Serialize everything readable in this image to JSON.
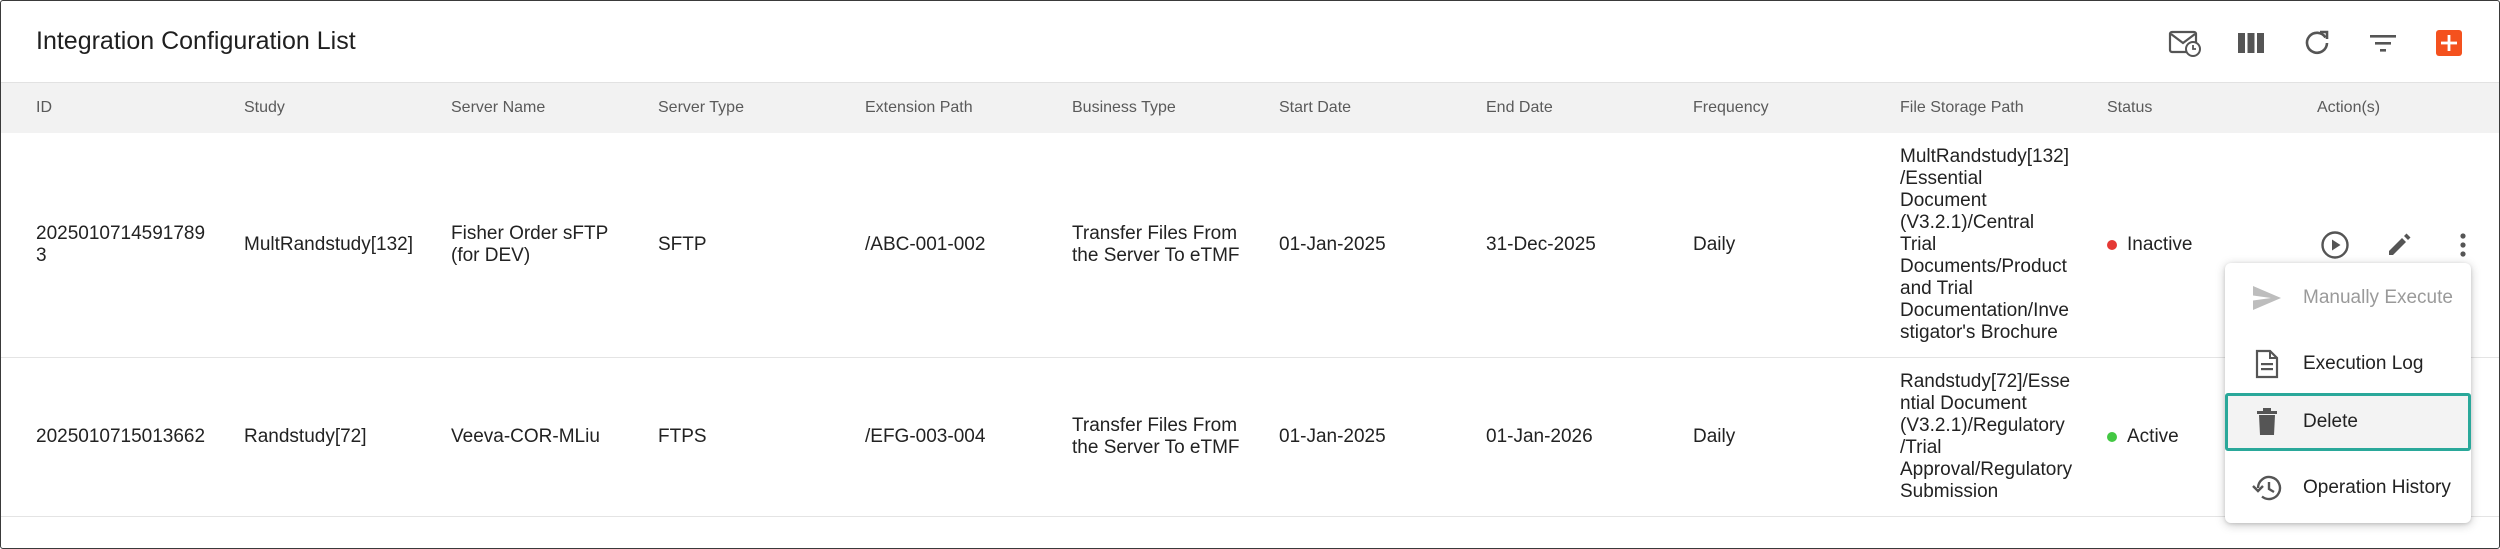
{
  "page": {
    "title": "Integration Configuration List"
  },
  "toolbar": {
    "icons": [
      "mail-schedule-icon",
      "columns-icon",
      "refresh-icon",
      "filter-icon",
      "add-icon"
    ],
    "accent": "#f4511e"
  },
  "table": {
    "columns": [
      "ID",
      "Study",
      "Server Name",
      "Server Type",
      "Extension Path",
      "Business Type",
      "Start Date",
      "End Date",
      "Frequency",
      "File Storage Path",
      "Status",
      "Action(s)"
    ],
    "rows": [
      {
        "id": "2025010714591789\n3",
        "study": "MultRandstudy[132]",
        "server_name": "Fisher Order sFTP\n(for DEV)",
        "server_type": "SFTP",
        "extension_path": "/ABC-001-002",
        "business_type": "Transfer Files From\nthe Server To eTMF",
        "start_date": "01-Jan-2025",
        "end_date": "31-Dec-2025",
        "frequency": "Daily",
        "file_storage_path": "MultRandstudy[132]\n/Essential\nDocument\n(V3.2.1)/Central\nTrial\nDocuments/Product\nand Trial\nDocumentation/Inve\nstigator's Brochure",
        "status": "Inactive",
        "status_color": "#e53935"
      },
      {
        "id": "2025010715013662",
        "study": "Randstudy[72]",
        "server_name": "Veeva-COR-MLiu",
        "server_type": "FTPS",
        "extension_path": "/EFG-003-004",
        "business_type": "Transfer Files From\nthe Server To eTMF",
        "start_date": "01-Jan-2025",
        "end_date": "01-Jan-2026",
        "frequency": "Daily",
        "file_storage_path": "Randstudy[72]/Esse\nntial Document\n(V3.2.1)/Regulatory\n/Trial\nApproval/Regulatory\nSubmission",
        "status": "Active",
        "status_color": "#43c843"
      }
    ]
  },
  "row_actions": [
    "execute-icon",
    "edit-icon",
    "more-options-icon"
  ],
  "context_menu": {
    "items": [
      {
        "label": "Manually Execute",
        "icon": "send-icon",
        "state": "disabled"
      },
      {
        "label": "Execution Log",
        "icon": "document-icon",
        "state": "normal"
      },
      {
        "label": "Delete",
        "icon": "trash-icon",
        "state": "selected"
      },
      {
        "label": "Operation History",
        "icon": "history-icon",
        "state": "normal"
      }
    ],
    "selected_outline_color": "#2aa89a"
  }
}
